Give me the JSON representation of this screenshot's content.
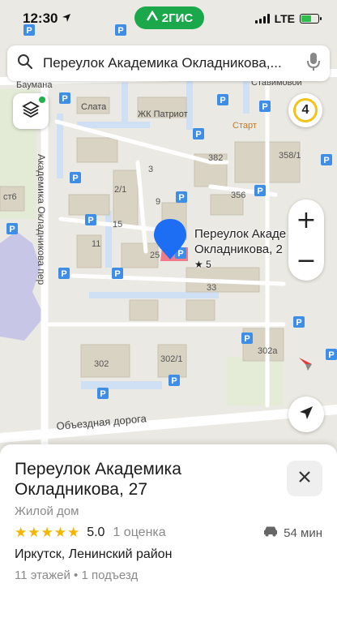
{
  "status_bar": {
    "time": "12:30",
    "network": "LTE",
    "app_badge": "2ГИС"
  },
  "search": {
    "value": "Переулок Академика Окладникова,..."
  },
  "traffic": {
    "level": "4"
  },
  "zoom": {
    "in_label": "+",
    "out_label": "−"
  },
  "map": {
    "pin_title_line1": "Переулок Акаде",
    "pin_title_line2": "Окладникова, 2",
    "pin_rating": "★ 5",
    "street_names": [
      "Академика Окладникова пер",
      "Объездная дорога",
      "Баумана",
      "Ставимовой"
    ],
    "places": [
      "Слата",
      "ЖК Патриот",
      "Старт"
    ],
    "building_numbers": [
      "382",
      "358/1",
      "356",
      "3",
      "9",
      "2/1",
      "15",
      "11",
      "25",
      "33",
      "302",
      "302/1",
      "302а",
      "ст6"
    ],
    "parking_label": "P"
  },
  "sheet": {
    "title": "Переулок Академика Окладникова, 27",
    "type": "Жилой дом",
    "rating_score": "5.0",
    "rating_count": "1 оценка",
    "stars": 5,
    "drive_time": "54 мин",
    "address": "Иркутск, Ленинский район",
    "details": "11 этажей • 1 подъезд"
  },
  "colors": {
    "accent": "#1e6ef3",
    "brand": "#1aa84a",
    "traffic": "#f4c21b",
    "parking": "#3e8ee8",
    "star": "#f4b400"
  }
}
